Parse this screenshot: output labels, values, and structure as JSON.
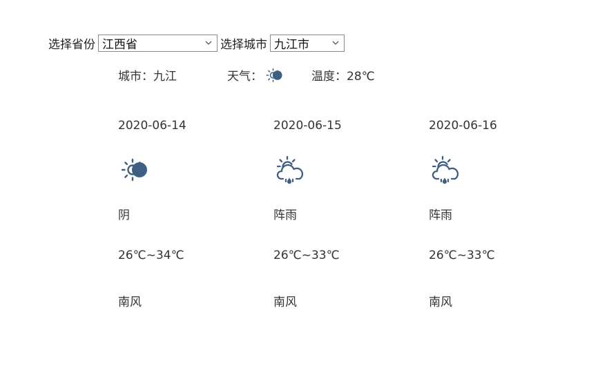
{
  "selectors": {
    "province_label": "选择省份",
    "province_value": "江西省",
    "city_label": "选择城市",
    "city_value": "九江市"
  },
  "current": {
    "city_label": "城市：",
    "city": "九江",
    "weather_label": "天气：",
    "weather_icon": "cloudy-sun-icon",
    "temp_label": "温度：",
    "temp": "28℃"
  },
  "forecast": [
    {
      "date": "2020-06-14",
      "icon": "cloudy-sun-icon",
      "weather": "阴",
      "temp": "26℃~34℃",
      "wind": "南风"
    },
    {
      "date": "2020-06-15",
      "icon": "shower-icon",
      "weather": "阵雨",
      "temp": "26℃~33℃",
      "wind": "南风"
    },
    {
      "date": "2020-06-16",
      "icon": "shower-icon",
      "weather": "阵雨",
      "temp": "26℃~33℃",
      "wind": "南风"
    }
  ],
  "colors": {
    "icon": "#3d5f84",
    "text": "#333333",
    "border": "#8a8a8a"
  }
}
